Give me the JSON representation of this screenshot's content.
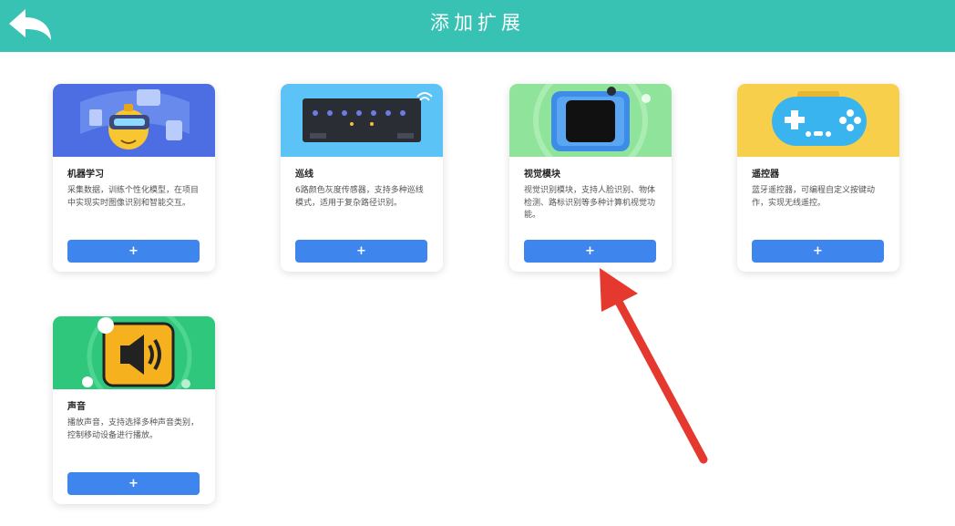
{
  "header": {
    "title": "添加扩展",
    "back_icon": "back-arrow-icon",
    "background": "#38c2b3"
  },
  "accent_color": "#3e86ee",
  "extensions": [
    {
      "title": "机器学习",
      "description": "采集数据，训练个性化模型，在项目中实现实时图像识别和智能交互。",
      "add_label": "+",
      "image": "robot-vr-illustration",
      "image_bg": "#4d6ee2"
    },
    {
      "title": "巡线",
      "description": "6路颜色灰度传感器，支持多种巡线模式，适用于复杂路径识别。",
      "add_label": "+",
      "image": "line-sensor-board-illustration",
      "image_bg": "#5bc3f6"
    },
    {
      "title": "视觉模块",
      "description": "视觉识别模块，支持人脸识别、物体检测、路标识别等多种计算机视觉功能。",
      "add_label": "+",
      "image": "vision-camera-module-illustration",
      "image_bg": "#8fe39b"
    },
    {
      "title": "遥控器",
      "description": "蓝牙遥控器，可编程自定义按键动作，实现无线遥控。",
      "add_label": "+",
      "image": "gamepad-illustration",
      "image_bg": "#f7cf4b"
    },
    {
      "title": "声音",
      "description": "播放声音，支持选择多种声音类别，控制移动设备进行播放。",
      "add_label": "+",
      "image": "speaker-illustration",
      "image_bg": "#2ec77c"
    }
  ],
  "annotation": {
    "arrow_icon": "red-pointer-arrow-icon",
    "color": "#e5382e"
  }
}
